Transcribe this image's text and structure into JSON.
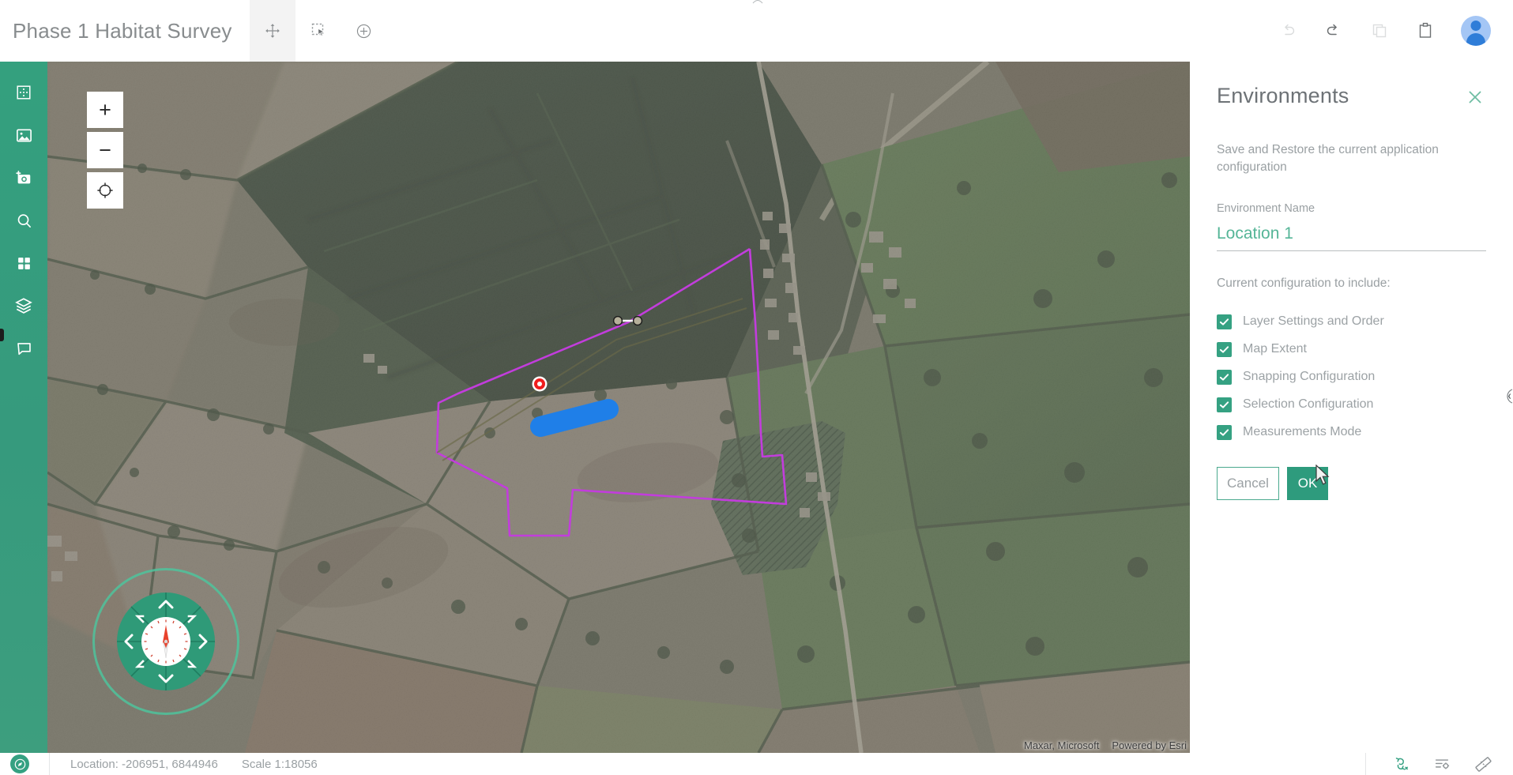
{
  "header": {
    "app_title": "Phase 1 Habitat Survey",
    "tools": [
      {
        "name": "pan-tool",
        "icon": "move-arrows-icon",
        "label": "Pan",
        "active": true
      },
      {
        "name": "select-tool",
        "icon": "marquee-select-icon",
        "label": "Select",
        "active": false
      },
      {
        "name": "add-tool",
        "icon": "plus-circle-icon",
        "label": "Add",
        "active": false
      }
    ],
    "actions": [
      {
        "name": "undo-button",
        "icon": "undo-icon",
        "label": "Undo",
        "enabled": false
      },
      {
        "name": "redo-button",
        "icon": "redo-icon",
        "label": "Redo",
        "enabled": true
      },
      {
        "name": "copy-button",
        "icon": "copy-icon",
        "label": "Copy",
        "enabled": false
      },
      {
        "name": "paste-button",
        "icon": "clipboard-paste-icon",
        "label": "Paste",
        "enabled": true
      }
    ],
    "avatar_label": "User account"
  },
  "sidebar": {
    "items": [
      {
        "name": "sidebar-item-extent",
        "icon": "extent-grid-icon",
        "label": "Extent"
      },
      {
        "name": "sidebar-item-basemap",
        "icon": "image-icon",
        "label": "Basemap"
      },
      {
        "name": "sidebar-item-capture",
        "icon": "add-photo-icon",
        "label": "Capture Photo"
      },
      {
        "name": "sidebar-item-search",
        "icon": "search-icon",
        "label": "Search"
      },
      {
        "name": "sidebar-item-apps",
        "icon": "grid-apps-icon",
        "label": "Apps"
      },
      {
        "name": "sidebar-item-layers",
        "icon": "layers-icon",
        "label": "Layers"
      },
      {
        "name": "sidebar-item-comments",
        "icon": "comment-icon",
        "label": "Comments"
      }
    ]
  },
  "map": {
    "zoom_controls": [
      {
        "name": "zoom-in-button",
        "icon": "plus-icon",
        "label": "+"
      },
      {
        "name": "zoom-out-button",
        "icon": "minus-icon",
        "label": "−"
      },
      {
        "name": "locate-button",
        "icon": "crosshair-target-icon",
        "label": "Locate"
      }
    ],
    "compass": {
      "name": "navigation-compass",
      "label": "Navigation compass",
      "heading_deg": 0
    },
    "attribution": [
      "Maxar, Microsoft",
      "Powered by Esri"
    ],
    "features": [
      {
        "name": "survey-boundary-polygon",
        "type": "polygon",
        "stroke": "#cc3ddd"
      },
      {
        "name": "point-feature-marker",
        "type": "point",
        "color": "#ff0000"
      },
      {
        "name": "line-feature-highlight",
        "type": "line",
        "color": "#1f7fe8"
      },
      {
        "name": "measurement-line",
        "type": "measure",
        "color": "#ffffff"
      },
      {
        "name": "hatched-habitat-polygon",
        "type": "polygon-hatched",
        "color": "#1e5c33"
      }
    ]
  },
  "panel": {
    "title": "Environments",
    "close_label": "Close",
    "description": "Save and Restore the current application configuration",
    "field_label": "Environment Name",
    "env_name_value": "Location 1",
    "env_name_placeholder": "Environment Name",
    "include_label": "Current configuration to include:",
    "checkboxes": [
      {
        "name": "checkbox-layer-settings",
        "label": "Layer Settings and Order",
        "checked": true
      },
      {
        "name": "checkbox-map-extent",
        "label": "Map Extent",
        "checked": true
      },
      {
        "name": "checkbox-snapping-configuration",
        "label": "Snapping Configuration",
        "checked": true
      },
      {
        "name": "checkbox-selection-configuration",
        "label": "Selection Configuration",
        "checked": true
      },
      {
        "name": "checkbox-measurements-mode",
        "label": "Measurements Mode",
        "checked": true
      }
    ],
    "cancel_label": "Cancel",
    "ok_label": "OK",
    "accent_color": "#35a182",
    "collapse_handle_label": "Collapse panel"
  },
  "status": {
    "badge_icon": "compass-badge-icon",
    "location_text": "Location: -206951, 6844946",
    "scale_text": "Scale 1:18056",
    "tools": [
      {
        "name": "snapping-toggle",
        "icon": "snapping-icon",
        "label": "Snapping",
        "active": true
      },
      {
        "name": "selection-settings-button",
        "icon": "selection-settings-icon",
        "label": "Selection settings",
        "active": false
      },
      {
        "name": "measure-tool-button",
        "icon": "ruler-icon",
        "label": "Measure",
        "active": false
      }
    ]
  }
}
